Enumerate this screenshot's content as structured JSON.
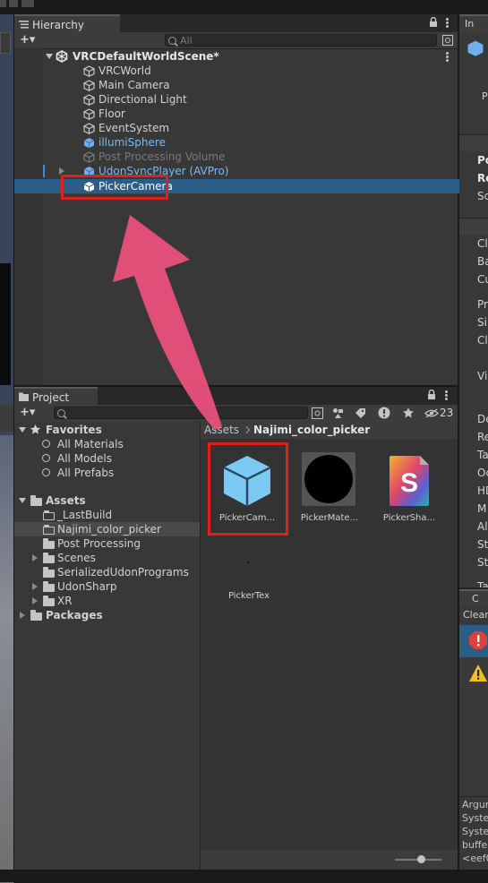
{
  "hierarchy": {
    "tab_label": "Hierarchy",
    "search_placeholder": "All",
    "add_label": "+▾",
    "scene_name": "VRCDefaultWorldScene*",
    "items": [
      {
        "label": "VRCWorld",
        "style": "normal"
      },
      {
        "label": "Main Camera",
        "style": "normal"
      },
      {
        "label": "Directional Light",
        "style": "normal"
      },
      {
        "label": "Floor",
        "style": "normal"
      },
      {
        "label": "EventSystem",
        "style": "normal"
      },
      {
        "label": "illumiSphere",
        "style": "prefab"
      },
      {
        "label": "Post Processing Volume",
        "style": "disabled"
      },
      {
        "label": "UdonSyncPlayer (AVPro)",
        "style": "prefab"
      },
      {
        "label": "PickerCamera",
        "style": "selected"
      }
    ]
  },
  "project": {
    "tab_label": "Project",
    "add_label": "+▾",
    "hidden_count": "23",
    "favorites_label": "Favorites",
    "favorites": [
      "All Materials",
      "All Models",
      "All Prefabs"
    ],
    "assets_label": "Assets",
    "asset_folders": [
      "_LastBuild",
      "Najimi_color_picker",
      "Post Processing",
      "Scenes",
      "SerializedUdonPrograms",
      "UdonSharp",
      "XR"
    ],
    "packages_label": "Packages",
    "breadcrumb": {
      "root": "Assets",
      "current": "Najimi_color_picker"
    },
    "grid_assets": [
      "PickerCam...",
      "PickerMate...",
      "PickerSha...",
      "PickerTex"
    ]
  },
  "inspector_partial": {
    "tab_label": "In",
    "row_labels": [
      "P",
      "Po",
      "Ro",
      "Sc",
      "Cl",
      "Ba",
      "Cu",
      "Pr",
      "Si",
      "Cl",
      "Vi",
      "De",
      "Re",
      "Ta",
      "Oc",
      "HD",
      "M",
      "Al",
      "St",
      "St",
      "Ta"
    ]
  },
  "console_partial": {
    "tab_label": "C",
    "clear_label": "Clear",
    "log_lines": [
      "Argur",
      "Syster",
      "Syster",
      "buffer",
      "<eef0"
    ]
  },
  "colors": {
    "selection": "#2c5d87",
    "prefab_blue": "#7cb8f0",
    "annotation_red": "#e0201c",
    "arrow_pink": "#e8507a"
  }
}
